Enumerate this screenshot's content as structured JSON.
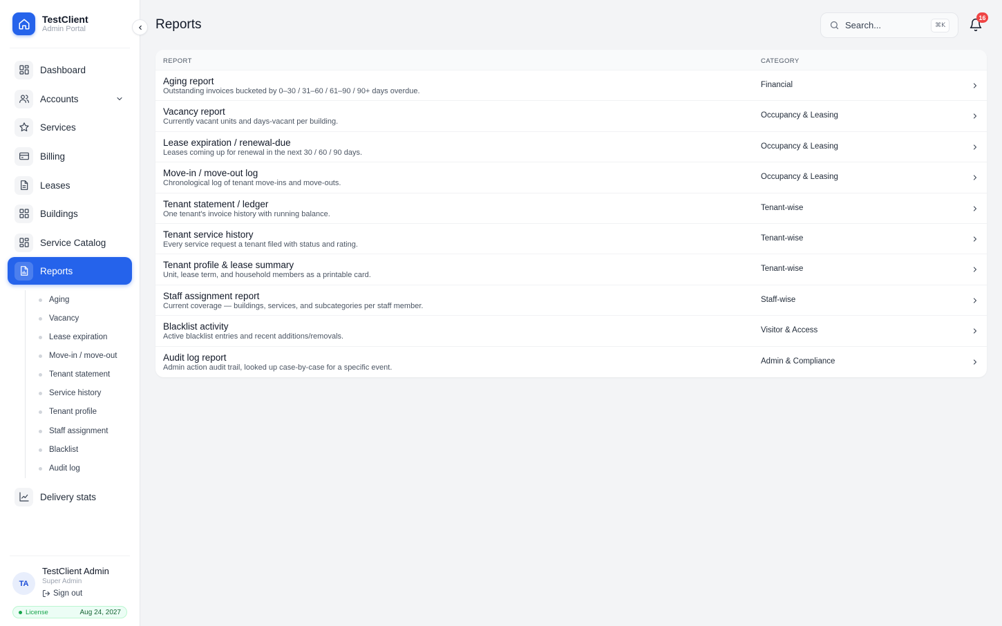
{
  "brand": {
    "name": "TestClient",
    "subtitle": "Admin Portal"
  },
  "nav": [
    {
      "label": "Dashboard",
      "icon": "dashboard-icon"
    },
    {
      "label": "Accounts",
      "icon": "users-icon"
    },
    {
      "label": "Services",
      "icon": "star-icon"
    },
    {
      "label": "Billing",
      "icon": "card-icon"
    },
    {
      "label": "Leases",
      "icon": "document-icon"
    },
    {
      "label": "Buildings",
      "icon": "grid-icon"
    },
    {
      "label": "Service Catalog",
      "icon": "grid-icon"
    },
    {
      "label": "Reports",
      "icon": "report-icon",
      "active": true
    },
    {
      "label": "Delivery stats",
      "icon": "chart-icon"
    }
  ],
  "report_subnav": [
    "Aging",
    "Vacancy",
    "Lease expiration",
    "Move-in / move-out",
    "Tenant statement",
    "Service history",
    "Tenant profile",
    "Staff assignment",
    "Blacklist",
    "Audit log"
  ],
  "user": {
    "initials": "TA",
    "name": "TestClient Admin",
    "role": "Super Admin",
    "signout": "Sign out"
  },
  "license": {
    "label": "License",
    "date": "Aug 24, 2027"
  },
  "header": {
    "title": "Reports",
    "search_placeholder": "Search...",
    "shortcut": "⌘K",
    "notification_count": "16"
  },
  "table": {
    "columns": {
      "report": "REPORT",
      "category": "CATEGORY"
    },
    "rows": [
      {
        "title": "Aging report",
        "description": "Outstanding invoices bucketed by 0–30 / 31–60 / 61–90 / 90+ days overdue.",
        "category": "Financial"
      },
      {
        "title": "Vacancy report",
        "description": "Currently vacant units and days-vacant per building.",
        "category": "Occupancy & Leasing"
      },
      {
        "title": "Lease expiration / renewal-due",
        "description": "Leases coming up for renewal in the next 30 / 60 / 90 days.",
        "category": "Occupancy & Leasing"
      },
      {
        "title": "Move-in / move-out log",
        "description": "Chronological log of tenant move-ins and move-outs.",
        "category": "Occupancy & Leasing"
      },
      {
        "title": "Tenant statement / ledger",
        "description": "One tenant's invoice history with running balance.",
        "category": "Tenant-wise"
      },
      {
        "title": "Tenant service history",
        "description": "Every service request a tenant filed with status and rating.",
        "category": "Tenant-wise"
      },
      {
        "title": "Tenant profile & lease summary",
        "description": "Unit, lease term, and household members as a printable card.",
        "category": "Tenant-wise"
      },
      {
        "title": "Staff assignment report",
        "description": "Current coverage — buildings, services, and subcategories per staff member.",
        "category": "Staff-wise"
      },
      {
        "title": "Blacklist activity",
        "description": "Active blacklist entries and recent additions/removals.",
        "category": "Visitor & Access"
      },
      {
        "title": "Audit log report",
        "description": "Admin action audit trail, looked up case-by-case for a specific event.",
        "category": "Admin & Compliance"
      }
    ]
  },
  "colors": {
    "accent": "#2563eb",
    "badge": "#ef4444",
    "license_green": "#16a34a"
  }
}
